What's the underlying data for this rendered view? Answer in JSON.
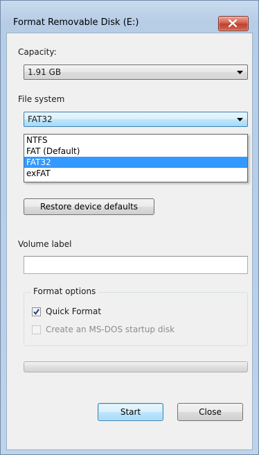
{
  "window": {
    "title": "Format Removable Disk (E:)"
  },
  "capacity": {
    "label": "Capacity:",
    "value": "1.91 GB"
  },
  "file_system": {
    "label": "File system",
    "value": "FAT32",
    "options": [
      "NTFS",
      "FAT (Default)",
      "FAT32",
      "exFAT"
    ],
    "selected_index": 2
  },
  "restore_defaults_label": "Restore device defaults",
  "volume_label": {
    "label": "Volume label",
    "value": ""
  },
  "format_options": {
    "title": "Format options",
    "quick_format": {
      "label": "Quick Format",
      "checked": true,
      "enabled": true
    },
    "ms_dos_disk": {
      "label": "Create an MS-DOS startup disk",
      "checked": false,
      "enabled": false
    }
  },
  "progress": {
    "value": 0
  },
  "buttons": {
    "start_label": "Start",
    "close_label": "Close"
  },
  "colors": {
    "selection": "#3399ff",
    "progress_fill": "#06b025",
    "close_button": "#c04030"
  },
  "icons": {
    "close": "close-x-icon",
    "dropdown": "chevron-down-icon",
    "check": "check-icon"
  }
}
